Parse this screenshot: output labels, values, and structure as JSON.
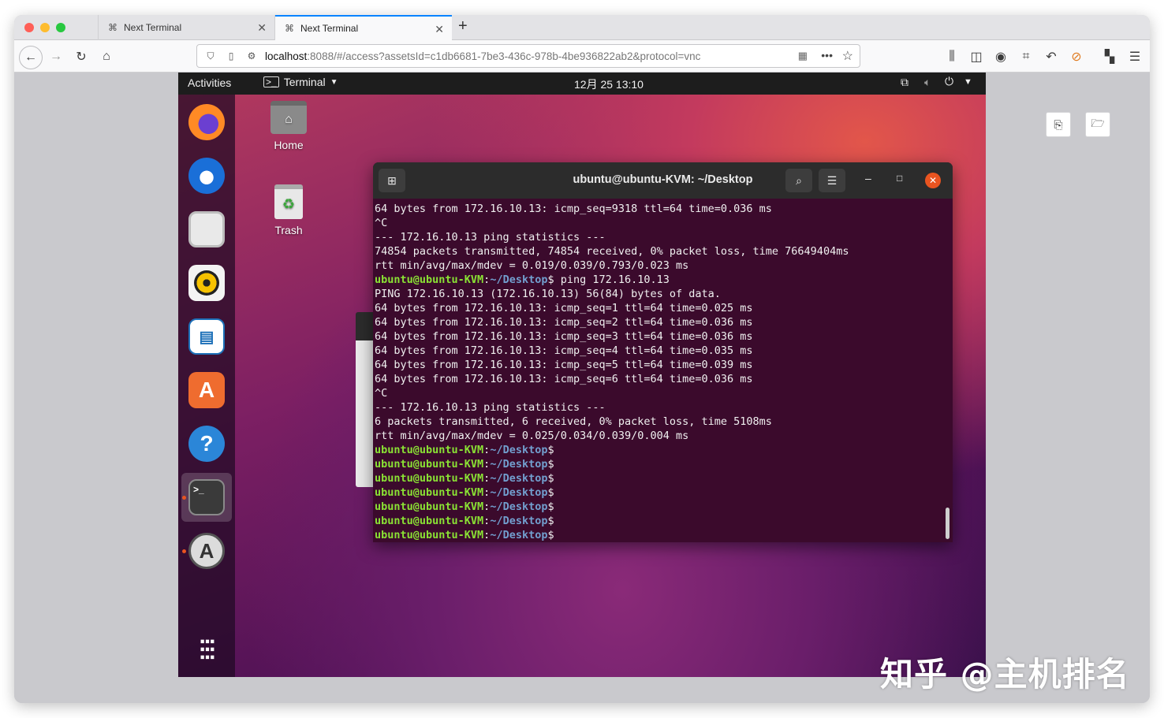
{
  "browser": {
    "tabs": [
      {
        "label": "Next Terminal",
        "active": false
      },
      {
        "label": "Next Terminal",
        "active": true
      }
    ],
    "url_host": "localhost",
    "url_rest": ":8088/#/access?assetsId=c1db6681-7be3-436c-978b-4be936822ab2&protocol=vnc",
    "accent": "#0a84ff"
  },
  "ubuntu": {
    "activities": "Activities",
    "app_menu": "Terminal",
    "clock": "12月 25  13:10",
    "dock_items": [
      "firefox-icon",
      "thunderbird-icon",
      "files-icon",
      "rhythmbox-icon",
      "writer-icon",
      "software-icon",
      "help-icon",
      "terminal-icon",
      "updater-icon",
      "app-grid-icon"
    ],
    "desktop_icons": {
      "home": "Home",
      "trash": "Trash"
    }
  },
  "terminal": {
    "title": "ubuntu@ubuntu-KVM: ~/Desktop",
    "prompt_user": "ubuntu@ubuntu-KVM",
    "prompt_dir": "~/Desktop",
    "lines": [
      "64 bytes from 172.16.10.13: icmp_seq=9318 ttl=64 time=0.036 ms",
      "^C",
      "--- 172.16.10.13 ping statistics ---",
      "74854 packets transmitted, 74854 received, 0% packet loss, time 76649404ms",
      "rtt min/avg/max/mdev = 0.019/0.039/0.793/0.023 ms"
    ],
    "command": "ping 172.16.10.13",
    "lines2": [
      "PING 172.16.10.13 (172.16.10.13) 56(84) bytes of data.",
      "64 bytes from 172.16.10.13: icmp_seq=1 ttl=64 time=0.025 ms",
      "64 bytes from 172.16.10.13: icmp_seq=2 ttl=64 time=0.036 ms",
      "64 bytes from 172.16.10.13: icmp_seq=3 ttl=64 time=0.036 ms",
      "64 bytes from 172.16.10.13: icmp_seq=4 ttl=64 time=0.035 ms",
      "64 bytes from 172.16.10.13: icmp_seq=5 ttl=64 time=0.039 ms",
      "64 bytes from 172.16.10.13: icmp_seq=6 ttl=64 time=0.036 ms",
      "^C",
      "--- 172.16.10.13 ping statistics ---",
      "6 packets transmitted, 6 received, 0% packet loss, time 5108ms",
      "rtt min/avg/max/mdev = 0.025/0.034/0.039/0.004 ms"
    ],
    "empty_prompts": 7
  },
  "watermark": "知乎 @主机排名"
}
